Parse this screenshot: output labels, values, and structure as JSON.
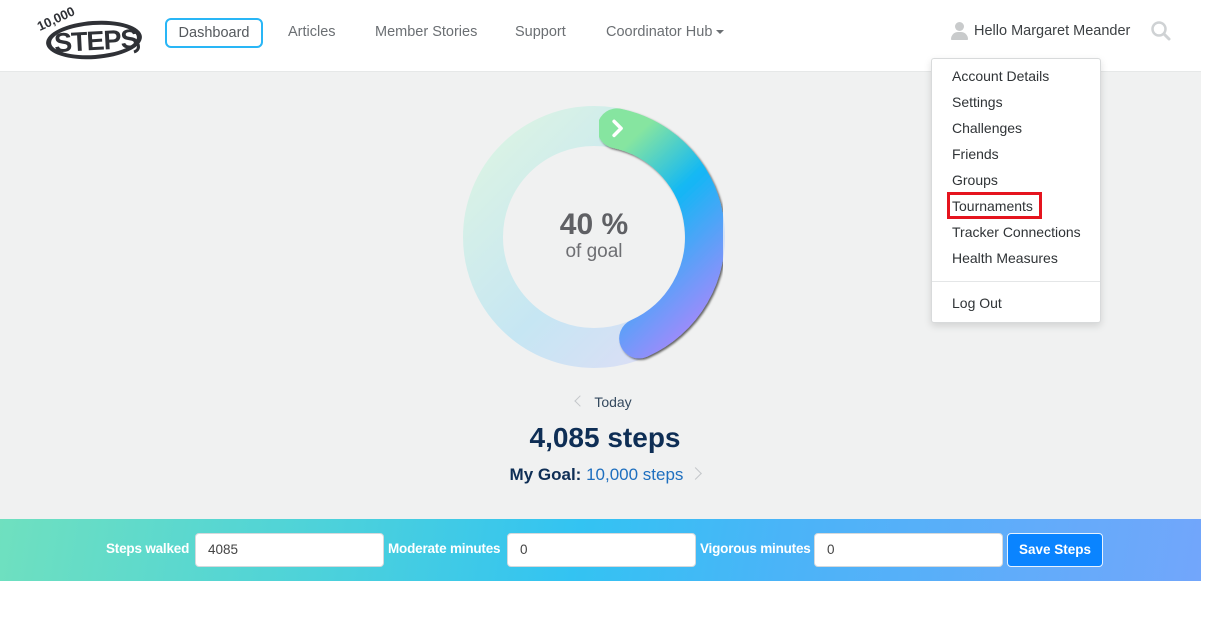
{
  "header": {
    "logo_alt": "10,000 Steps",
    "nav": [
      {
        "label": "Dashboard",
        "active": true
      },
      {
        "label": "Articles"
      },
      {
        "label": "Member Stories"
      },
      {
        "label": "Support"
      },
      {
        "label": "Coordinator Hub",
        "has_dropdown": true
      }
    ],
    "user_greeting": "Hello Margaret Meander",
    "icons": {
      "user": "user-icon",
      "search": "search-icon"
    }
  },
  "user_menu": {
    "items": [
      {
        "label": "Account Details"
      },
      {
        "label": "Settings"
      },
      {
        "label": "Challenges"
      },
      {
        "label": "Friends"
      },
      {
        "label": "Groups"
      },
      {
        "label": "Tournaments",
        "highlighted": true
      },
      {
        "label": "Tracker Connections"
      },
      {
        "label": "Health Measures"
      }
    ],
    "logout_label": "Log Out",
    "highlight_color": "#e5141e"
  },
  "progress": {
    "percent": 40,
    "percent_label": "40 %",
    "sub_label": "of goal",
    "colors": [
      "#86e5a0",
      "#12b7f5",
      "#9a8cfb"
    ]
  },
  "day": {
    "label": "Today",
    "steps_label": "4,085 steps",
    "goal_prefix": "My Goal:",
    "goal_value": "10,000 steps"
  },
  "entry_bar": {
    "steps_label": "Steps walked",
    "steps_value": "4085",
    "moderate_label": "Moderate minutes",
    "moderate_value": "0",
    "vigorous_label": "Vigorous minutes",
    "vigorous_value": "0",
    "save_label": "Save Steps"
  }
}
